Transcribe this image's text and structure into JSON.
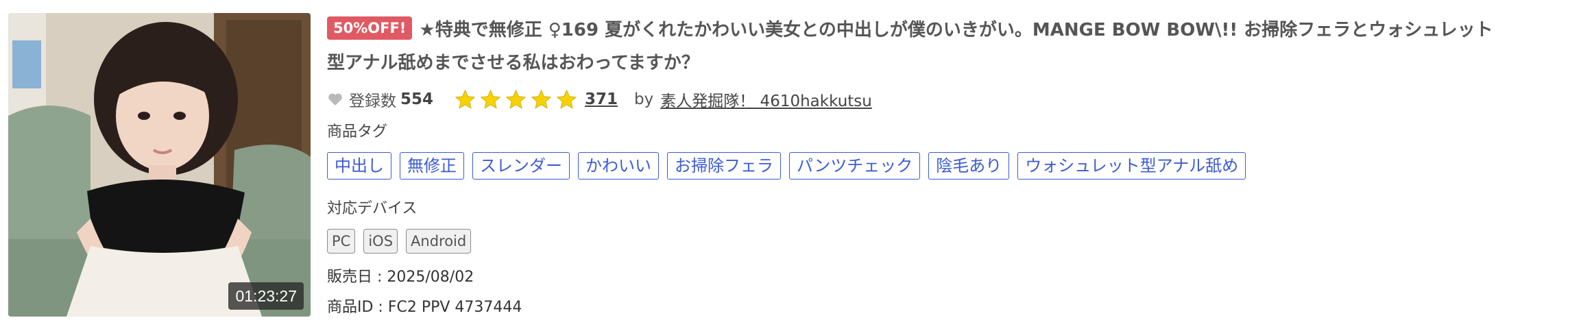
{
  "product": {
    "thumbnail": {
      "alt": "",
      "duration": "01:23:27"
    },
    "sale_badge": "50%OFF!",
    "title_line1": "★特典で無修正 ♀169 夏がくれたかわいい美女との中出しが僕のいきがい。MANGE BOW BOW\\!! お掃除フェラとウォシュレット",
    "title_line2": "型アナル舐めまでさせる私はおわってますか？",
    "favorites": {
      "label": "登録数",
      "count": "554"
    },
    "rating": {
      "stars": 5,
      "count": "371",
      "star_color": "#f7d200"
    },
    "seller": {
      "prefix": "by",
      "name": "素人発掘隊！ 4610hakkutsu"
    },
    "tags_label": "商品タグ",
    "tags": [
      "中出し",
      "無修正",
      "スレンダー",
      "かわいい",
      "お掃除フェラ",
      "パンツチェック",
      "陰毛あり",
      "ウォシュレット型アナル舐め"
    ],
    "devices_label": "対応デバイス",
    "devices": [
      "PC",
      "iOS",
      "Android"
    ],
    "release_date": "販売日 : 2025/08/02",
    "product_id": "商品ID : FC2 PPV 4737444"
  },
  "colors": {
    "badge": "#e05a63",
    "tag_border": "#3b5bd5",
    "star": "#f7d200"
  },
  "icons": {
    "heart": "heart-icon",
    "star": "star-icon"
  }
}
